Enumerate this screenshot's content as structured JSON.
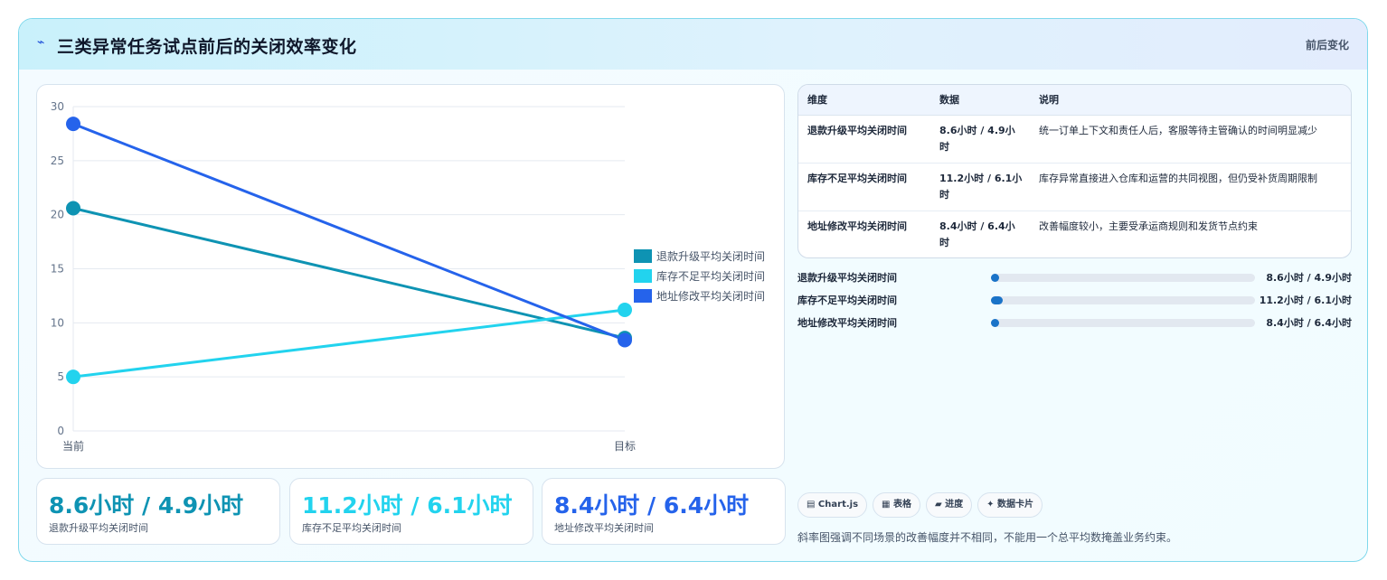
{
  "header": {
    "icon": "lightning-icon",
    "title": "三类异常任务试点前后的关闭效率变化",
    "tag": "前后变化"
  },
  "chart_data": {
    "type": "line",
    "categories": [
      "当前",
      "目标"
    ],
    "ylim": [
      0,
      30
    ],
    "yticks": [
      0,
      5,
      10,
      15,
      20,
      25,
      30
    ],
    "legend_position": "right",
    "grid": true,
    "series": [
      {
        "name": "退款升级平均关闭时间",
        "values": [
          20.6,
          8.6
        ],
        "color": "#0e93b3"
      },
      {
        "name": "库存不足平均关闭时间",
        "values": [
          5.0,
          11.2
        ],
        "color": "#22d3ee"
      },
      {
        "name": "地址修改平均关闭时间",
        "values": [
          28.4,
          8.4
        ],
        "color": "#2563eb"
      }
    ]
  },
  "stats": [
    {
      "value": "8.6小时 / 4.9小时",
      "label": "退款升级平均关闭时间",
      "color": "#0e93b3"
    },
    {
      "value": "11.2小时 / 6.1小时",
      "label": "库存不足平均关闭时间",
      "color": "#22d3ee"
    },
    {
      "value": "8.4小时 / 6.4小时",
      "label": "地址修改平均关闭时间",
      "color": "#2563eb"
    }
  ],
  "table": {
    "headers": [
      "维度",
      "数据",
      "说明"
    ],
    "rows": [
      [
        "退款升级平均关闭时间",
        "8.6小时 / 4.9小时",
        "统一订单上下文和责任人后，客服等待主管确认的时间明显减少"
      ],
      [
        "库存不足平均关闭时间",
        "11.2小时 / 6.1小时",
        "库存异常直接进入仓库和运营的共同视图，但仍受补货周期限制"
      ],
      [
        "地址修改平均关闭时间",
        "8.4小时 / 6.4小时",
        "改善幅度较小，主要受承运商规则和发货节点约束"
      ]
    ]
  },
  "progress": [
    {
      "label": "退款升级平均关闭时间",
      "value": "8.6小时 / 4.9小时",
      "fraction": 0.03
    },
    {
      "label": "库存不足平均关闭时间",
      "value": "11.2小时 / 6.1小时",
      "fraction": 0.045
    },
    {
      "label": "地址修改平均关闭时间",
      "value": "8.4小时 / 6.4小时",
      "fraction": 0.03
    }
  ],
  "chips": [
    "▤ Chart.js",
    "▦ 表格",
    "▰ 进度",
    "✦ 数据卡片"
  ],
  "note": "斜率图强调不同场景的改善幅度并不相同，不能用一个总平均数掩盖业务约束。"
}
